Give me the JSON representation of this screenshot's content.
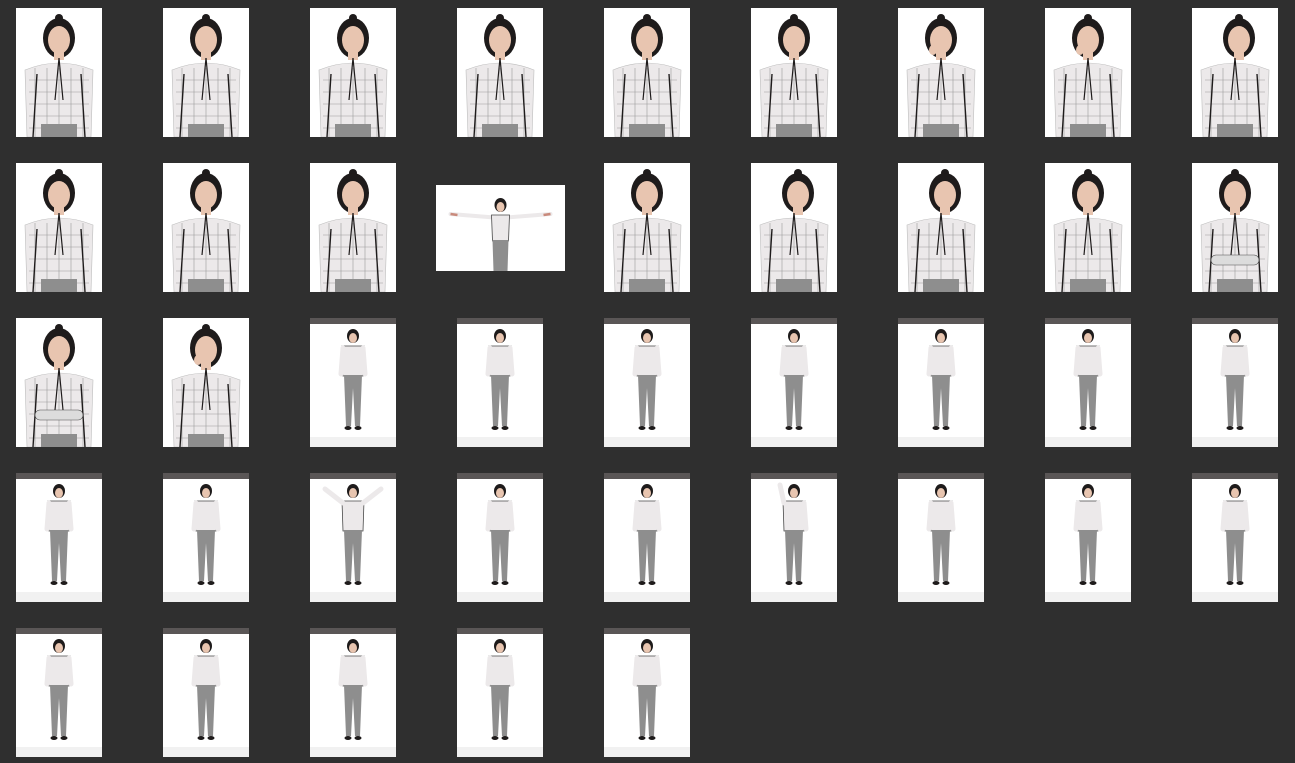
{
  "contact_sheet": {
    "background_color": "#2f2f2f",
    "thumbnails": [
      {
        "orientation": "portrait",
        "framing": "half-body",
        "pose": "front"
      },
      {
        "orientation": "portrait",
        "framing": "half-body",
        "pose": "front"
      },
      {
        "orientation": "portrait",
        "framing": "half-body",
        "pose": "front"
      },
      {
        "orientation": "portrait",
        "framing": "half-body",
        "pose": "front"
      },
      {
        "orientation": "portrait",
        "framing": "half-body",
        "pose": "front"
      },
      {
        "orientation": "portrait",
        "framing": "half-body",
        "pose": "front"
      },
      {
        "orientation": "portrait",
        "framing": "half-body",
        "pose": "hand-to-face"
      },
      {
        "orientation": "portrait",
        "framing": "half-body",
        "pose": "hand-to-face"
      },
      {
        "orientation": "portrait",
        "framing": "half-body",
        "pose": "turned"
      },
      {
        "orientation": "portrait",
        "framing": "half-body",
        "pose": "front"
      },
      {
        "orientation": "portrait",
        "framing": "half-body",
        "pose": "front"
      },
      {
        "orientation": "portrait",
        "framing": "half-body",
        "pose": "front"
      },
      {
        "orientation": "landscape",
        "framing": "half-body",
        "pose": "arms-outstretched"
      },
      {
        "orientation": "portrait",
        "framing": "half-body",
        "pose": "front"
      },
      {
        "orientation": "portrait",
        "framing": "half-body",
        "pose": "turned"
      },
      {
        "orientation": "portrait",
        "framing": "half-body",
        "pose": "turned"
      },
      {
        "orientation": "portrait",
        "framing": "half-body",
        "pose": "front"
      },
      {
        "orientation": "portrait",
        "framing": "half-body",
        "pose": "arms-crossed"
      },
      {
        "orientation": "portrait",
        "framing": "half-body",
        "pose": "arms-crossed"
      },
      {
        "orientation": "portrait",
        "framing": "half-body",
        "pose": "hand-to-face"
      },
      {
        "orientation": "portrait",
        "framing": "full-body",
        "pose": "front"
      },
      {
        "orientation": "portrait",
        "framing": "full-body",
        "pose": "front"
      },
      {
        "orientation": "portrait",
        "framing": "full-body",
        "pose": "turned"
      },
      {
        "orientation": "portrait",
        "framing": "full-body",
        "pose": "front"
      },
      {
        "orientation": "portrait",
        "framing": "full-body",
        "pose": "turned"
      },
      {
        "orientation": "portrait",
        "framing": "full-body",
        "pose": "front"
      },
      {
        "orientation": "portrait",
        "framing": "full-body",
        "pose": "turned"
      },
      {
        "orientation": "portrait",
        "framing": "full-body",
        "pose": "front"
      },
      {
        "orientation": "portrait",
        "framing": "full-body",
        "pose": "front"
      },
      {
        "orientation": "portrait",
        "framing": "full-body",
        "pose": "arms-raised"
      },
      {
        "orientation": "portrait",
        "framing": "full-body",
        "pose": "front"
      },
      {
        "orientation": "portrait",
        "framing": "full-body",
        "pose": "turned"
      },
      {
        "orientation": "portrait",
        "framing": "full-body",
        "pose": "arm-raised"
      },
      {
        "orientation": "portrait",
        "framing": "full-body",
        "pose": "turned"
      },
      {
        "orientation": "portrait",
        "framing": "full-body",
        "pose": "front"
      },
      {
        "orientation": "portrait",
        "framing": "full-body",
        "pose": "turned"
      },
      {
        "orientation": "portrait",
        "framing": "full-body",
        "pose": "front"
      },
      {
        "orientation": "portrait",
        "framing": "full-body",
        "pose": "arms-crossed"
      },
      {
        "orientation": "portrait",
        "framing": "full-body",
        "pose": "hand-to-face"
      },
      {
        "orientation": "portrait",
        "framing": "full-body",
        "pose": "hand-to-face"
      },
      {
        "orientation": "portrait",
        "framing": "full-body",
        "pose": "hand-to-face"
      }
    ]
  }
}
